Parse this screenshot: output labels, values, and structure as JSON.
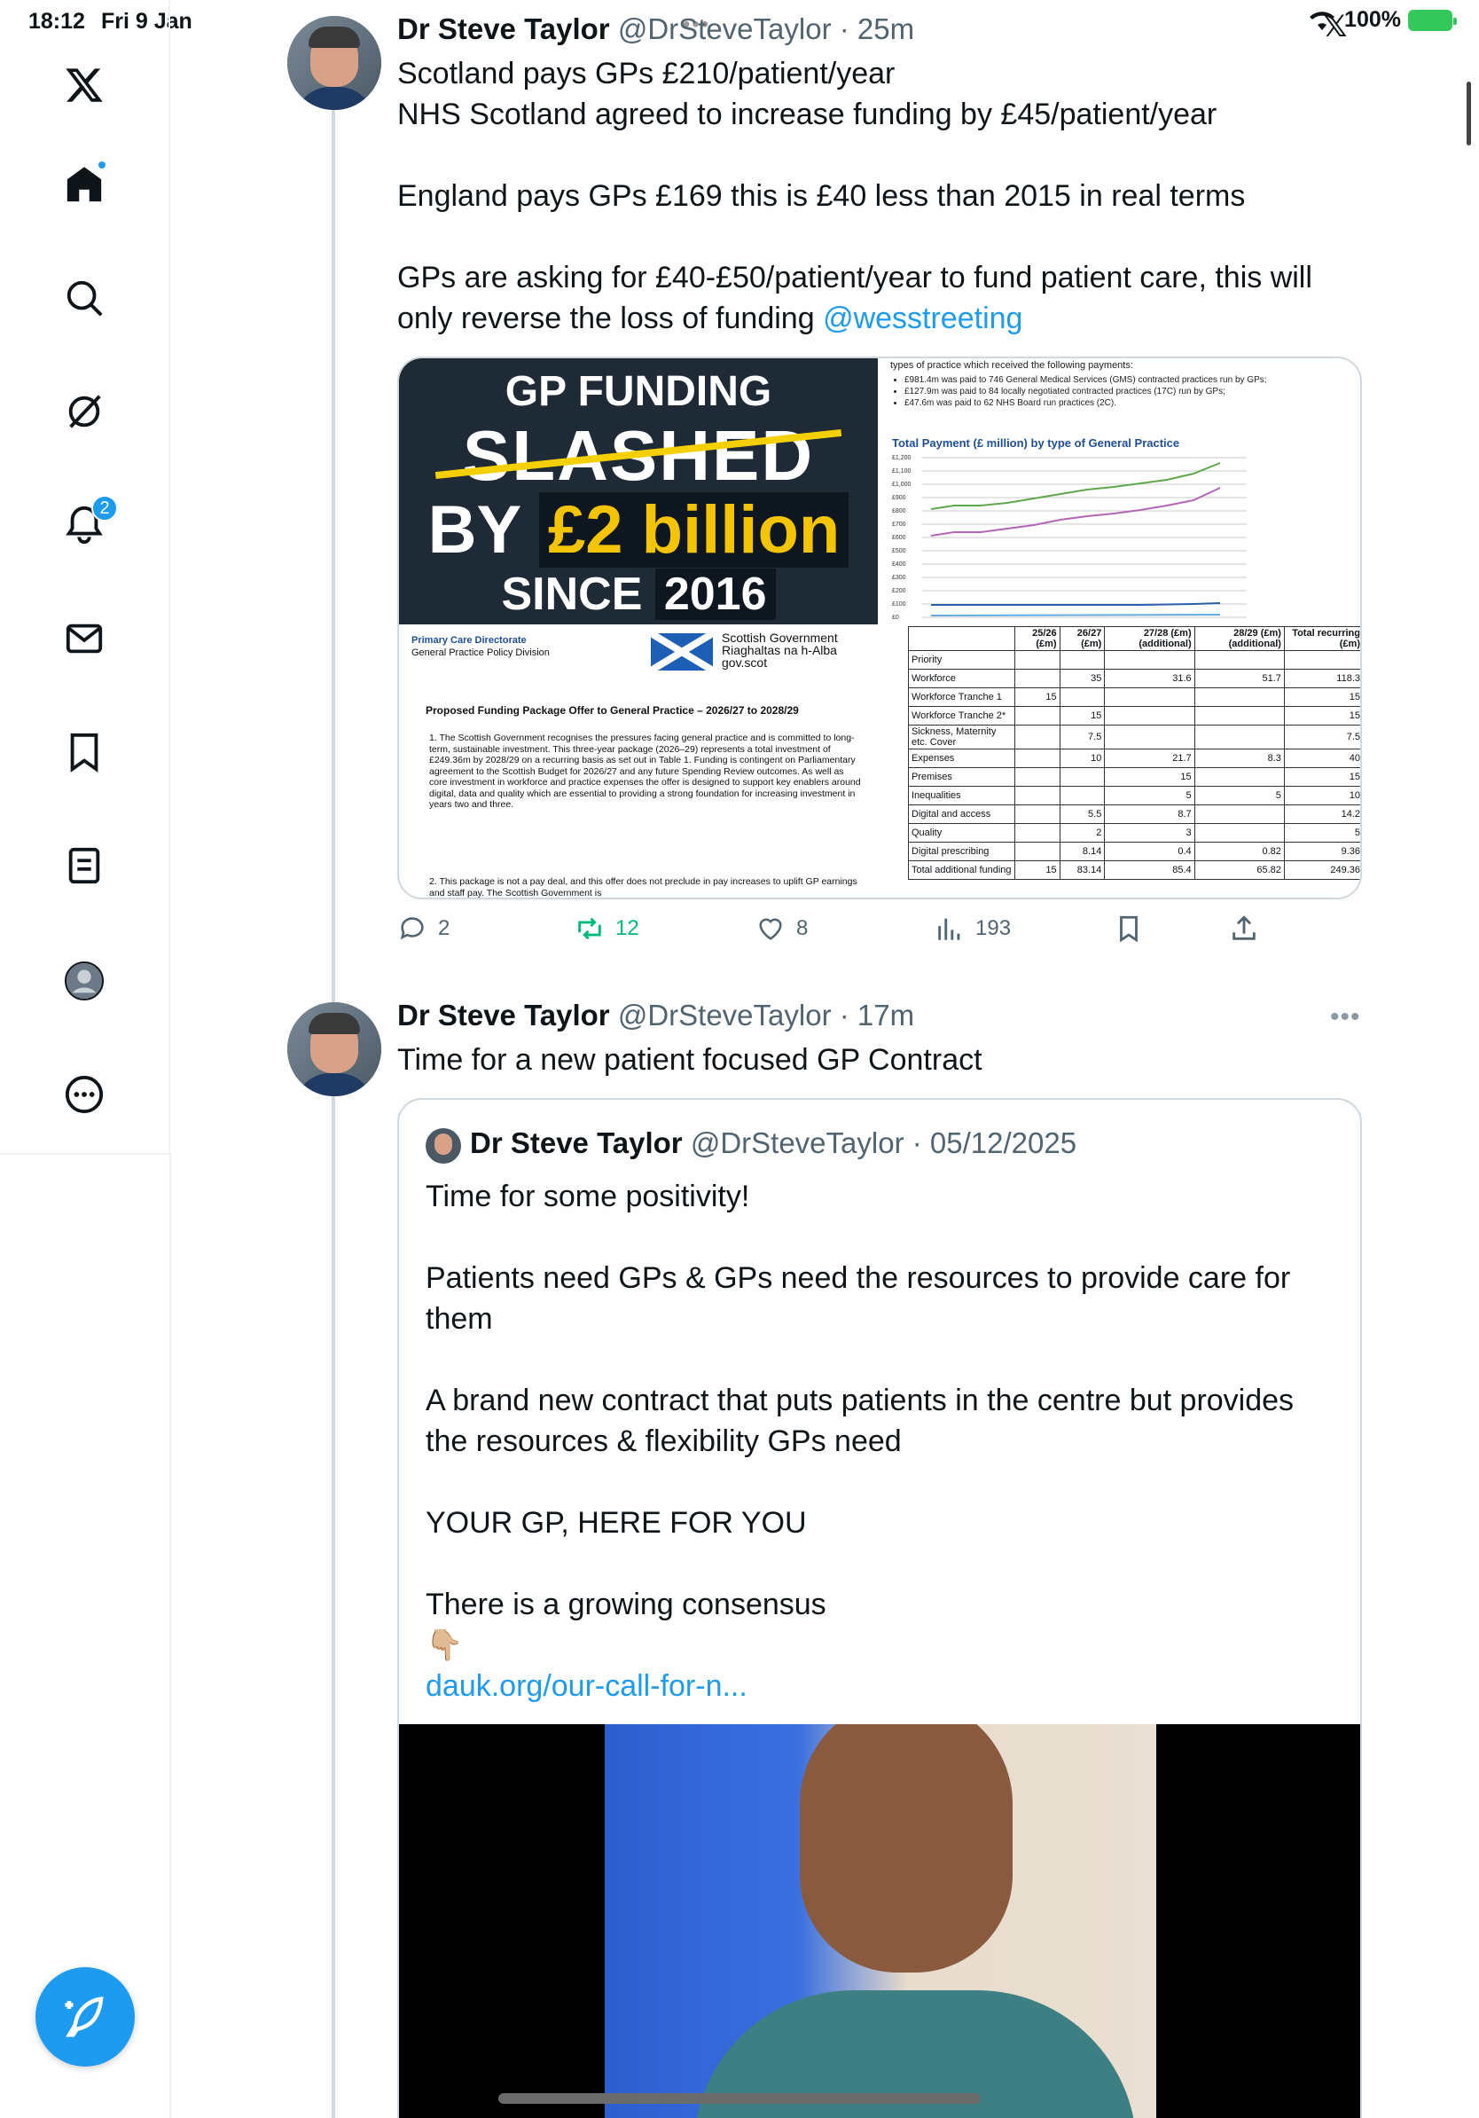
{
  "status": {
    "time": "18:12",
    "date": "Fri 9 Jan",
    "battery": "100%"
  },
  "sidebar": {
    "items": [
      {
        "name": "x-logo",
        "icon": "x-logo-icon"
      },
      {
        "name": "home",
        "icon": "home-icon"
      },
      {
        "name": "explore",
        "icon": "search-icon"
      },
      {
        "name": "grok",
        "icon": "grok-icon"
      },
      {
        "name": "notifications",
        "icon": "bell-icon",
        "badge": "2"
      },
      {
        "name": "messages",
        "icon": "mail-icon"
      },
      {
        "name": "bookmarks",
        "icon": "bookmark-icon"
      },
      {
        "name": "lists",
        "icon": "list-icon"
      },
      {
        "name": "profile",
        "icon": "profile-icon"
      },
      {
        "name": "more",
        "icon": "more-circle-icon"
      }
    ]
  },
  "tweet1": {
    "name": "Dr Steve Taylor",
    "handle": "@DrSteveTaylor",
    "time": "· 25m",
    "text": "Scotland pays GPs £210/patient/year\nNHS Scotland agreed to increase funding by £45/patient/year\n\nEngland pays GPs £169 this is £40 less than 2015 in real terms\n\nGPs are asking for £40-£50/patient/year to fund patient care, this will\nonly reverse the loss of funding ",
    "mention": "@wesstreeting",
    "media": {
      "poster": {
        "line1": "GP FUNDING",
        "line2": "SLASHED",
        "line3a": "BY",
        "line3b": "£2 billion",
        "line4a": "SINCE",
        "line4b": "2016"
      },
      "chart_header": "types of practice which received the following payments:",
      "chart_bullets": [
        "£981.4m was paid to 746 General Medical Services (GMS) contracted practices run by GPs;",
        "£127.9m was paid to 84 locally negotiated contracted practices (17C) run by GPs;",
        "£47.6m was paid to 62 NHS Board run practices (2C)."
      ],
      "chart_title": "Total Payment (£ million) by type of General Practice",
      "chart_yticks": [
        "£1,200",
        "£1,100",
        "£1,000",
        "£900",
        "£800",
        "£700",
        "£600",
        "£500",
        "£400",
        "£300",
        "£200",
        "£100",
        "£0"
      ],
      "doc": {
        "org": "Primary Care Directorate",
        "division": "General Practice Policy Division",
        "gov1": "Scottish Government",
        "gov2": "Riaghaltas na h-Alba",
        "gov3": "gov.scot",
        "title": "Proposed Funding Package Offer to General Practice – 2026/27 to 2028/29",
        "p1": "1.  The Scottish Government recognises the pressures facing general practice and is committed to long-term, sustainable investment. This three-year package (2026–29) represents a total investment of £249.36m by 2028/29 on a recurring basis as set out in Table 1. Funding is contingent on Parliamentary agreement to the Scottish Budget for 2026/27 and any future Spending Review outcomes. As well as core investment in workforce and practice expenses the offer is designed to support key enablers around digital, data and quality which are essential to providing a strong foundation for increasing investment in years two and three.",
        "p2": "2.  This package is not a pay deal, and this offer does not preclude in pay increases to uplift GP earnings and staff pay. The Scottish Government is"
      },
      "table": {
        "headers": [
          "",
          "25/26 (£m)",
          "26/27 (£m)",
          "27/28 (£m) (additional)",
          "28/29 (£m) (additional)",
          "Total recurring (£m)"
        ],
        "rows": [
          [
            "Priority",
            "",
            "",
            "",
            "",
            ""
          ],
          [
            "Workforce",
            "",
            "35",
            "31.6",
            "51.7",
            "118.3"
          ],
          [
            "Workforce Tranche 1",
            "15",
            "",
            "",
            "",
            "15"
          ],
          [
            "Workforce Tranche 2*",
            "",
            "15",
            "",
            "",
            "15"
          ],
          [
            "Sickness, Maternity etc. Cover",
            "",
            "7.5",
            "",
            "",
            "7.5"
          ],
          [
            "Expenses",
            "",
            "10",
            "21.7",
            "8.3",
            "40"
          ],
          [
            "Premises",
            "",
            "",
            "15",
            "",
            "15"
          ],
          [
            "Inequalities",
            "",
            "",
            "5",
            "5",
            "10"
          ],
          [
            "Digital and access",
            "",
            "5.5",
            "8.7",
            "",
            "14.2"
          ],
          [
            "Quality",
            "",
            "2",
            "3",
            "",
            "5"
          ],
          [
            "Digital prescribing",
            "",
            "8.14",
            "0.4",
            "0.82",
            "9.36"
          ],
          [
            "Total additional funding",
            "15",
            "83.14",
            "85.4",
            "65.82",
            "249.36"
          ]
        ]
      }
    },
    "actions": {
      "replies": "2",
      "reposts": "12",
      "likes": "8",
      "views": "193"
    }
  },
  "tweet2": {
    "name": "Dr Steve Taylor",
    "handle": "@DrSteveTaylor",
    "time": "· 17m",
    "text": "Time for a new patient focused GP Contract",
    "quote": {
      "name": "Dr Steve Taylor",
      "handle": "@DrSteveTaylor",
      "date": "· 05/12/2025",
      "text": "Time for some positivity!\n\nPatients need GPs & GPs need the resources to provide care for\nthem\n\nA brand new contract that puts patients in the centre but provides\nthe resources & flexibility GPs need\n\nYOUR GP, HERE FOR YOU\n\nThere is a growing consensus\n👇🏼",
      "link": "dauk.org/our-call-for-n..."
    }
  },
  "colors": {
    "accent": "#1d9bf0",
    "repost_green": "#00ba7c",
    "text_secondary": "#536471"
  }
}
